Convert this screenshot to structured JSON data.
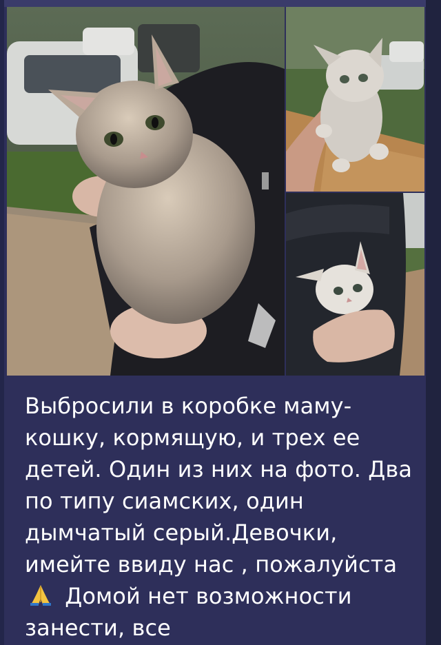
{
  "message": {
    "photos": [
      {
        "subject": "grey tabby mother cat held in arms"
      },
      {
        "subject": "small grey kitten held up by hand"
      },
      {
        "subject": "light kitten peeking out of jacket"
      }
    ],
    "text_part1": "Выбросили в коробке маму-кошку, кормящую, и трех ее детей. Один из них на фото. Два по типу сиамских, один дымчатый серый.Девочки, имейте ввиду нас , пожалуйста",
    "emoji": "folded-hands",
    "text_part2": " Домой нет возможности занести, все"
  },
  "colors": {
    "bubble": "#2e2f5a",
    "background": "#23264a",
    "text": "#ffffff"
  }
}
